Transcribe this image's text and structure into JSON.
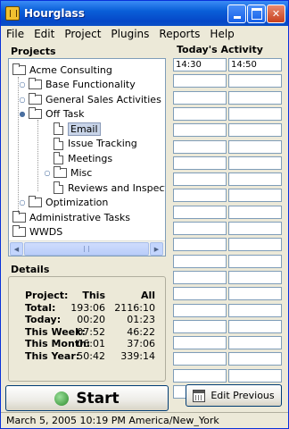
{
  "window": {
    "title": "Hourglass",
    "min_icon": "minimize-icon",
    "max_icon": "maximize-icon",
    "close_icon": "close-icon"
  },
  "menu": [
    "File",
    "Edit",
    "Project",
    "Plugins",
    "Reports",
    "Help"
  ],
  "projects": {
    "label": "Projects",
    "tree": [
      {
        "label": "Acme Consulting",
        "type": "folder",
        "level": 0,
        "toggle": ""
      },
      {
        "label": "Base Functionality",
        "type": "folder",
        "level": 1,
        "toggle": "collapsed"
      },
      {
        "label": "General Sales Activities",
        "type": "folder",
        "level": 1,
        "toggle": "collapsed"
      },
      {
        "label": "Off Task",
        "type": "folder",
        "level": 1,
        "toggle": "expanded"
      },
      {
        "label": "Email",
        "type": "doc",
        "level": 2,
        "toggle": "",
        "selected": true
      },
      {
        "label": "Issue Tracking",
        "type": "doc",
        "level": 2,
        "toggle": ""
      },
      {
        "label": "Meetings",
        "type": "doc",
        "level": 2,
        "toggle": ""
      },
      {
        "label": "Misc",
        "type": "folder",
        "level": 2,
        "toggle": "collapsed"
      },
      {
        "label": "Reviews and Inspections",
        "type": "doc",
        "level": 2,
        "toggle": ""
      },
      {
        "label": "Optimization",
        "type": "folder",
        "level": 1,
        "toggle": "collapsed"
      },
      {
        "label": "Administrative Tasks",
        "type": "folder",
        "level": 0,
        "toggle": ""
      },
      {
        "label": "WWDS",
        "type": "folder",
        "level": 0,
        "toggle": ""
      }
    ]
  },
  "details": {
    "label": "Details",
    "header": {
      "label": "Project:",
      "this": "This",
      "all": "All"
    },
    "rows": [
      {
        "label": "Total:",
        "this": "193:06",
        "all": "2116:10"
      },
      {
        "label": "Today:",
        "this": "00:20",
        "all": "01:23"
      },
      {
        "label": "This Week:",
        "this": "07:52",
        "all": "46:22"
      },
      {
        "label": "This Month:",
        "this": "06:01",
        "all": "37:06"
      },
      {
        "label": "This Year:",
        "this": "50:42",
        "all": "339:14"
      }
    ]
  },
  "activity": {
    "label": "Today's Activity",
    "entries": [
      [
        "14:30",
        "14:50"
      ]
    ]
  },
  "buttons": {
    "start": "Start",
    "start_icon": "start-clock-icon",
    "edit_previous": "Edit Previous",
    "edit_previous_icon": "calendar-icon"
  },
  "statusbar": {
    "text": "March 5, 2005 10:19 PM America/New_York"
  }
}
